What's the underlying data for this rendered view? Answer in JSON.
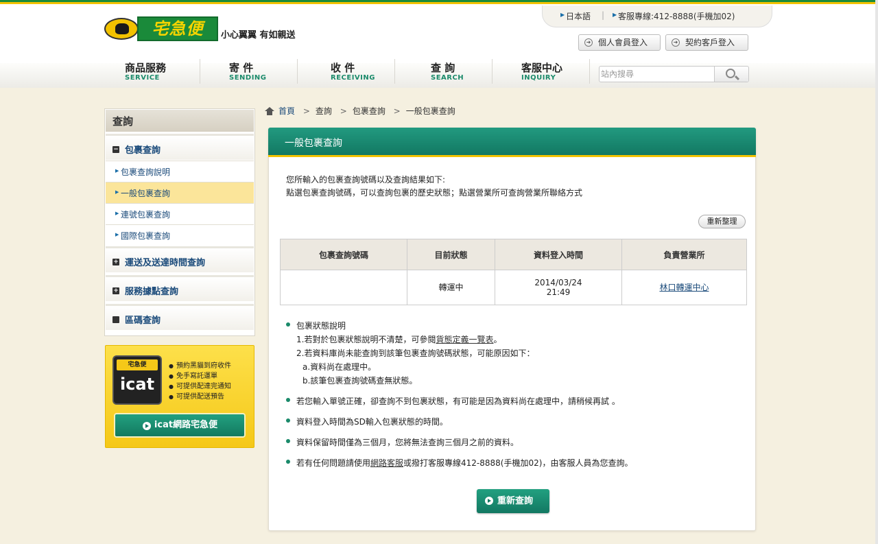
{
  "header": {
    "logo_text": "宅急便",
    "slogan": "小心翼翼 有如親送",
    "lang_link": "日本語",
    "hotline": "客服專線:412-8888(手機加02)",
    "member_login": "個人會員登入",
    "contract_login": "契約客戶登入",
    "search_placeholder": "站內搜尋"
  },
  "nav": [
    {
      "zh": "商品服務",
      "en": "SERVICE"
    },
    {
      "zh": "寄 件",
      "en": "SENDING"
    },
    {
      "zh": "收 件",
      "en": "RECEIVING"
    },
    {
      "zh": "查 詢",
      "en": "SEARCH"
    },
    {
      "zh": "客服中心",
      "en": "INQUIRY"
    }
  ],
  "sidebar": {
    "title": "查詢",
    "group1": "包裹查詢",
    "sub": [
      "包裹查詢說明",
      "一般包裹查詢",
      "連號包裹查詢",
      "國際包裹查詢"
    ],
    "group2": "運送及送達時間查詢",
    "group3": "服務據點查詢",
    "group4": "區碼查詢"
  },
  "icat": {
    "logo_top": "宅急便",
    "logo_word": "icat",
    "features": [
      "預約黑貓到府收件",
      "免手寫託運單",
      "可提供配達完通知",
      "可提供配送預告"
    ],
    "button": "icat網路宅急便"
  },
  "breadcrumb": [
    "首頁",
    "查詢",
    "包裹查詢",
    "一般包裹查詢"
  ],
  "panel": {
    "title": "一般包裹查詢",
    "intro1": "您所輸入的包裹查詢號碼以及查詢結果如下:",
    "intro2": "點選包裹查詢號碼，可以查詢包裹的歷史狀態；點選營業所可查詢營業所聯絡方式",
    "refresh": "重新整理",
    "columns": [
      "包裹查詢號碼",
      "目前狀態",
      "資料登入時間",
      "負責營業所"
    ],
    "row": {
      "status": "轉運中",
      "date": "2014/03/24",
      "time": "21:49",
      "office": "林口轉運中心"
    },
    "notes": {
      "n1_title": "包裹狀態說明",
      "n1_l1a": "1.若對於包裹狀態說明不清楚，可參閱",
      "n1_l1_link": "貨態定義一覽表",
      "n1_l1b": "。",
      "n1_l2": "2.若資料庫尚未能查詢到該筆包裹查詢號碼狀態，可能原因如下：",
      "n1_a": "a.資料尚在處理中。",
      "n1_b": "b.該筆包裹查詢號碼查無狀態。",
      "n2": "若您輸入單號正確，卻查詢不到包裹狀態，有可能是因為資料尚在處理中，請稍候再試 。",
      "n3": "資料登入時間為SD輸入包裹狀態的時間。",
      "n4": "資料保留時間僅為三個月，您將無法查詢三個月之前的資料。",
      "n5a": "若有任何問題請使用",
      "n5_link": "網路客服",
      "n5b": "或撥打客服專線412-8888(手機加02)，由客服人員為您查詢。"
    },
    "requery": "重新查詢"
  }
}
